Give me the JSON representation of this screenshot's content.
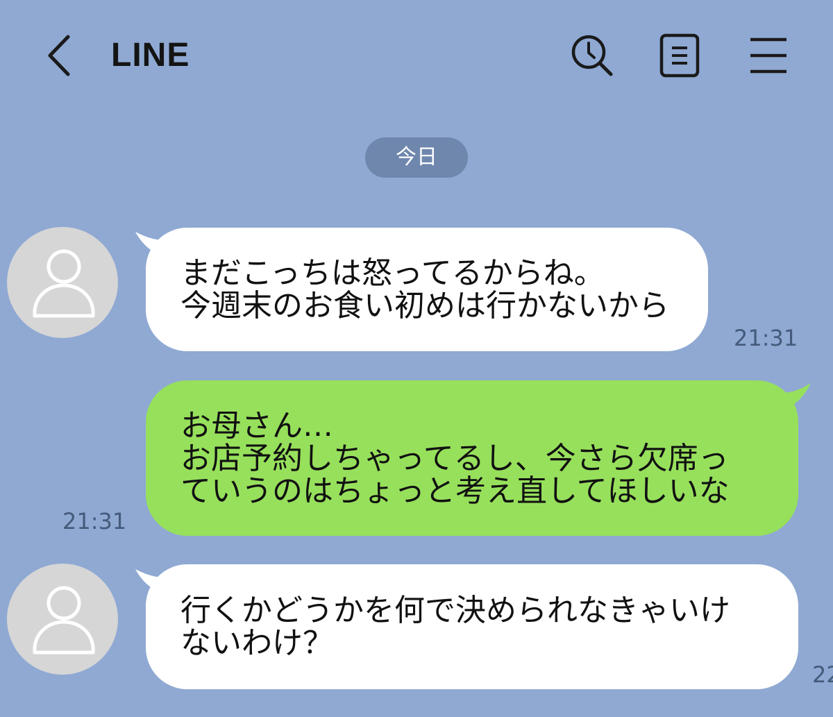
{
  "colors": {
    "background": "#8fa9d3",
    "incoming_bubble": "#ffffff",
    "outgoing_bubble": "#97e05c",
    "date_pill": "#6f86ad"
  },
  "header": {
    "back_icon": "chevron-left-icon",
    "title": "LINE",
    "icons": [
      "search-clock-icon",
      "notes-icon",
      "menu-icon"
    ]
  },
  "date_divider": "今日",
  "messages": [
    {
      "direction": "incoming",
      "avatar_icon": "user-icon",
      "lines": [
        "まだこっちは怒ってるからね。",
        "今週末のお食い初めは行かないから"
      ],
      "time": "21:31"
    },
    {
      "direction": "outgoing",
      "lines": [
        "お母さん…",
        "お店予約しちゃってるし、今さら欠席っ",
        "ていうのはちょっと考え直してほしいな"
      ],
      "time": "21:31"
    },
    {
      "direction": "incoming",
      "avatar_icon": "user-icon",
      "lines": [
        "行くかどうかを何で決められなきゃいけ",
        "ないわけ？"
      ],
      "time": "22"
    }
  ]
}
